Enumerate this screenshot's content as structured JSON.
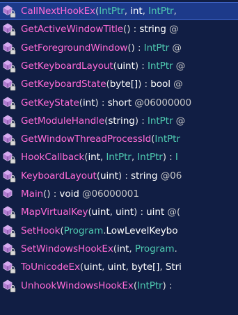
{
  "colors": {
    "background": "#111e44",
    "selected_row": "#1d3a8a",
    "method_name": "#ff6bd6",
    "type_name": "#4ec9b0",
    "text": "#ffffff",
    "icon": "#b07ad0"
  },
  "members": [
    {
      "icon": "method-lock-icon",
      "selected": true,
      "parts": [
        {
          "k": "name",
          "t": "CallNextHookEx"
        },
        {
          "k": "punc",
          "t": "("
        },
        {
          "k": "type",
          "t": "IntPtr"
        },
        {
          "k": "punc",
          "t": ", "
        },
        {
          "k": "kw",
          "t": "int"
        },
        {
          "k": "punc",
          "t": ", "
        },
        {
          "k": "type",
          "t": "IntPtr"
        },
        {
          "k": "punc",
          "t": ", "
        }
      ]
    },
    {
      "icon": "method-lock-icon",
      "parts": [
        {
          "k": "name",
          "t": "GetActiveWindowTitle"
        },
        {
          "k": "punc",
          "t": "() : "
        },
        {
          "k": "kw",
          "t": "string"
        },
        {
          "k": "tok",
          "t": " @"
        }
      ]
    },
    {
      "icon": "method-lock-icon",
      "parts": [
        {
          "k": "name",
          "t": "GetForegroundWindow"
        },
        {
          "k": "punc",
          "t": "() : "
        },
        {
          "k": "type",
          "t": "IntPtr"
        },
        {
          "k": "tok",
          "t": " @"
        }
      ]
    },
    {
      "icon": "method-lock-icon",
      "parts": [
        {
          "k": "name",
          "t": "GetKeyboardLayout"
        },
        {
          "k": "punc",
          "t": "("
        },
        {
          "k": "kw",
          "t": "uint"
        },
        {
          "k": "punc",
          "t": ") : "
        },
        {
          "k": "type",
          "t": "IntPtr"
        },
        {
          "k": "tok",
          "t": " @"
        }
      ]
    },
    {
      "icon": "method-lock-icon",
      "parts": [
        {
          "k": "name",
          "t": "GetKeyboardState"
        },
        {
          "k": "punc",
          "t": "("
        },
        {
          "k": "kw",
          "t": "byte[]"
        },
        {
          "k": "punc",
          "t": ") : "
        },
        {
          "k": "kw",
          "t": "bool"
        },
        {
          "k": "tok",
          "t": " @"
        }
      ]
    },
    {
      "icon": "method-lock-icon",
      "parts": [
        {
          "k": "name",
          "t": "GetKeyState"
        },
        {
          "k": "punc",
          "t": "("
        },
        {
          "k": "kw",
          "t": "int"
        },
        {
          "k": "punc",
          "t": ") : "
        },
        {
          "k": "kw",
          "t": "short"
        },
        {
          "k": "tok",
          "t": " @06000000"
        }
      ]
    },
    {
      "icon": "method-lock-icon",
      "parts": [
        {
          "k": "name",
          "t": "GetModuleHandle"
        },
        {
          "k": "punc",
          "t": "("
        },
        {
          "k": "kw",
          "t": "string"
        },
        {
          "k": "punc",
          "t": ") : "
        },
        {
          "k": "type",
          "t": "IntPtr"
        },
        {
          "k": "tok",
          "t": " @"
        }
      ]
    },
    {
      "icon": "method-lock-icon",
      "parts": [
        {
          "k": "name",
          "t": "GetWindowThreadProcessId"
        },
        {
          "k": "punc",
          "t": "("
        },
        {
          "k": "type",
          "t": "IntPtr"
        }
      ]
    },
    {
      "icon": "method-lock-icon",
      "parts": [
        {
          "k": "name",
          "t": "HookCallback"
        },
        {
          "k": "punc",
          "t": "("
        },
        {
          "k": "kw",
          "t": "int"
        },
        {
          "k": "punc",
          "t": ", "
        },
        {
          "k": "type",
          "t": "IntPtr"
        },
        {
          "k": "punc",
          "t": ", "
        },
        {
          "k": "type",
          "t": "IntPtr"
        },
        {
          "k": "punc",
          "t": ") : "
        },
        {
          "k": "type",
          "t": "I"
        }
      ]
    },
    {
      "icon": "method-lock-icon",
      "parts": [
        {
          "k": "name",
          "t": "KeyboardLayout"
        },
        {
          "k": "punc",
          "t": "("
        },
        {
          "k": "kw",
          "t": "uint"
        },
        {
          "k": "punc",
          "t": ") : "
        },
        {
          "k": "kw",
          "t": "string"
        },
        {
          "k": "tok",
          "t": " @06"
        }
      ]
    },
    {
      "icon": "method-icon",
      "parts": [
        {
          "k": "name",
          "t": "Main"
        },
        {
          "k": "punc",
          "t": "() : "
        },
        {
          "k": "kw",
          "t": "void"
        },
        {
          "k": "tok",
          "t": " @06000001"
        }
      ]
    },
    {
      "icon": "method-lock-icon",
      "parts": [
        {
          "k": "name",
          "t": "MapVirtualKey"
        },
        {
          "k": "punc",
          "t": "("
        },
        {
          "k": "kw",
          "t": "uint"
        },
        {
          "k": "punc",
          "t": ", "
        },
        {
          "k": "kw",
          "t": "uint"
        },
        {
          "k": "punc",
          "t": ") : "
        },
        {
          "k": "kw",
          "t": "uint"
        },
        {
          "k": "tok",
          "t": " @("
        }
      ]
    },
    {
      "icon": "method-lock-icon",
      "parts": [
        {
          "k": "name",
          "t": "SetHook"
        },
        {
          "k": "punc",
          "t": "("
        },
        {
          "k": "type",
          "t": "Program"
        },
        {
          "k": "punc",
          "t": "."
        },
        {
          "k": "kw",
          "t": "LowLevelKeybo"
        }
      ]
    },
    {
      "icon": "method-lock-icon",
      "parts": [
        {
          "k": "name",
          "t": "SetWindowsHookEx"
        },
        {
          "k": "punc",
          "t": "("
        },
        {
          "k": "kw",
          "t": "int"
        },
        {
          "k": "punc",
          "t": ", "
        },
        {
          "k": "type",
          "t": "Program"
        },
        {
          "k": "punc",
          "t": "."
        }
      ]
    },
    {
      "icon": "method-lock-icon",
      "parts": [
        {
          "k": "name",
          "t": "ToUnicodeEx"
        },
        {
          "k": "punc",
          "t": "("
        },
        {
          "k": "kw",
          "t": "uint"
        },
        {
          "k": "punc",
          "t": ", "
        },
        {
          "k": "kw",
          "t": "uint"
        },
        {
          "k": "punc",
          "t": ", "
        },
        {
          "k": "kw",
          "t": "byte[]"
        },
        {
          "k": "punc",
          "t": ", "
        },
        {
          "k": "kw",
          "t": "Stri"
        }
      ]
    },
    {
      "icon": "method-lock-icon",
      "parts": [
        {
          "k": "name",
          "t": "UnhookWindowsHookEx"
        },
        {
          "k": "punc",
          "t": "("
        },
        {
          "k": "type",
          "t": "IntPtr"
        },
        {
          "k": "punc",
          "t": ") : "
        }
      ]
    }
  ]
}
